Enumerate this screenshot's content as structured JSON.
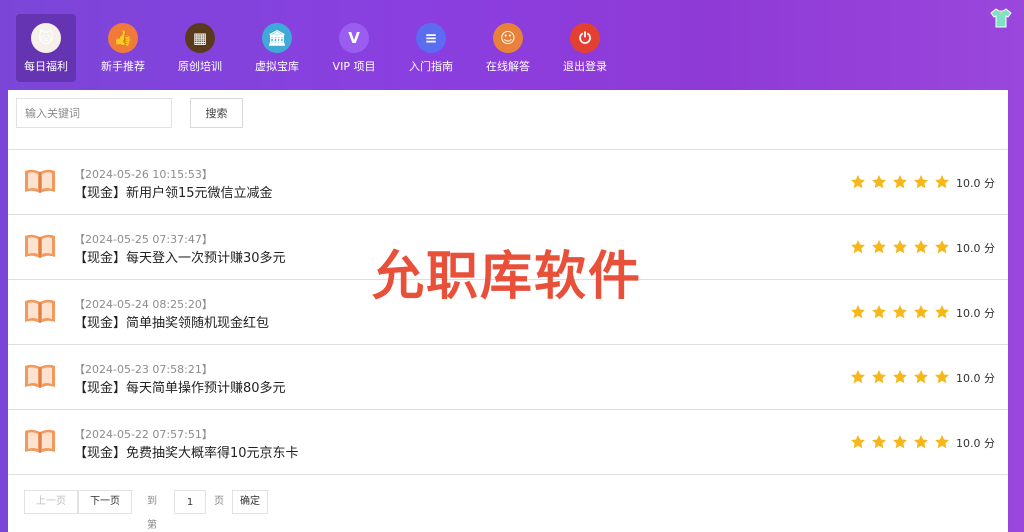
{
  "nav": {
    "items": [
      {
        "label": "每日福利",
        "icon": "lucky-cat-icon",
        "glyph": "🐱",
        "color": "#f5f0ea"
      },
      {
        "label": "新手推荐",
        "icon": "thumbs-up-icon",
        "glyph": "👍",
        "color": "#f07a3a"
      },
      {
        "label": "原创培训",
        "icon": "blackboard-icon",
        "glyph": "▦",
        "color": "#5a3a1c"
      },
      {
        "label": "虚拟宝库",
        "icon": "bank-icon",
        "glyph": "🏛",
        "color": "#3fa9d8"
      },
      {
        "label": "VIP 项目",
        "icon": "vip-icon",
        "glyph": "V",
        "color": "#9b5cf0"
      },
      {
        "label": "入门指南",
        "icon": "document-icon",
        "glyph": "≡",
        "color": "#5b6cf0"
      },
      {
        "label": "在线解答",
        "icon": "support-agent-icon",
        "glyph": "☺",
        "color": "#e8823a"
      },
      {
        "label": "退出登录",
        "icon": "power-icon",
        "glyph": "⏻",
        "color": "#e44032"
      }
    ],
    "active_index": 0
  },
  "search": {
    "placeholder": "输入关键词",
    "button_label": "搜索"
  },
  "posts": [
    {
      "date": "【2024-05-26 10:15:53】",
      "title": "【现金】新用户领15元微信立减金",
      "rating": 5,
      "score": "10.0 分"
    },
    {
      "date": "【2024-05-25 07:37:47】",
      "title": "【现金】每天登入一次预计赚30多元",
      "rating": 5,
      "score": "10.0 分"
    },
    {
      "date": "【2024-05-24 08:25:20】",
      "title": "【现金】简单抽奖领随机现金红包",
      "rating": 5,
      "score": "10.0 分"
    },
    {
      "date": "【2024-05-23 07:58:21】",
      "title": "【现金】每天简单操作预计赚80多元",
      "rating": 5,
      "score": "10.0 分"
    },
    {
      "date": "【2024-05-22 07:57:51】",
      "title": "【现金】免费抽奖大概率得10元京东卡",
      "rating": 5,
      "score": "10.0 分"
    }
  ],
  "watermark": "允职库软件",
  "pagination": {
    "prev_label": "上一页",
    "next_label": "下一页",
    "goto_prefix": "到第",
    "page_value": "1",
    "page_suffix": "页",
    "confirm_label": "确定"
  },
  "colors": {
    "star": "#f5b719",
    "watermark": "#e8503a",
    "book": "#f29a5c"
  }
}
